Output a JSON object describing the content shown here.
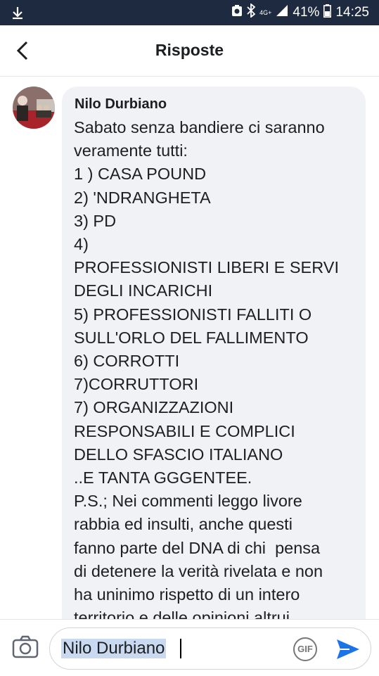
{
  "status_bar": {
    "network": "4G+",
    "battery": "41%",
    "time": "14:25"
  },
  "header": {
    "title": "Risposte"
  },
  "comment": {
    "author": "Nilo Durbiano",
    "lines": [
      "Sabato senza bandiere ci saranno",
      "veramente tutti:",
      "1 ) CASA POUND",
      "2) 'NDRANGHETA",
      "3) PD",
      "4)",
      "PROFESSIONISTI LIBERI E SERVI",
      "DEGLI INCARICHI",
      "5) PROFESSIONISTI FALLITI O",
      "SULL'ORLO DEL FALLIMENTO",
      "6) CORROTTI",
      "7)CORRUTTORI",
      "7) ORGANIZZAZIONI",
      "RESPONSABILI E COMPLICI",
      "DELLO SFASCIO ITALIANO",
      "..E TANTA GGGENTEE.",
      "P.S.; Nei commenti leggo livore",
      "rabbia ed insulti, anche questi",
      "fanno parte del DNA di chi  pensa",
      "di detenere la verità rivelata e non",
      "ha uninimo rispetto di un intero",
      "territorio e delle opinioni altrui."
    ]
  },
  "composer": {
    "input_value": "Nilo Durbiano",
    "gif_label": "GIF"
  },
  "icons": {
    "download": "download-icon",
    "back": "back-arrow-icon",
    "camera": "camera-icon",
    "send": "send-icon",
    "bluetooth": "bluetooth-icon",
    "signal": "signal-icon",
    "battery": "battery-icon"
  },
  "colors": {
    "status_bar": "#1d2a3f",
    "bubble": "#f1f2f6",
    "send": "#1a73e8",
    "selection": "#c9d9f0"
  }
}
